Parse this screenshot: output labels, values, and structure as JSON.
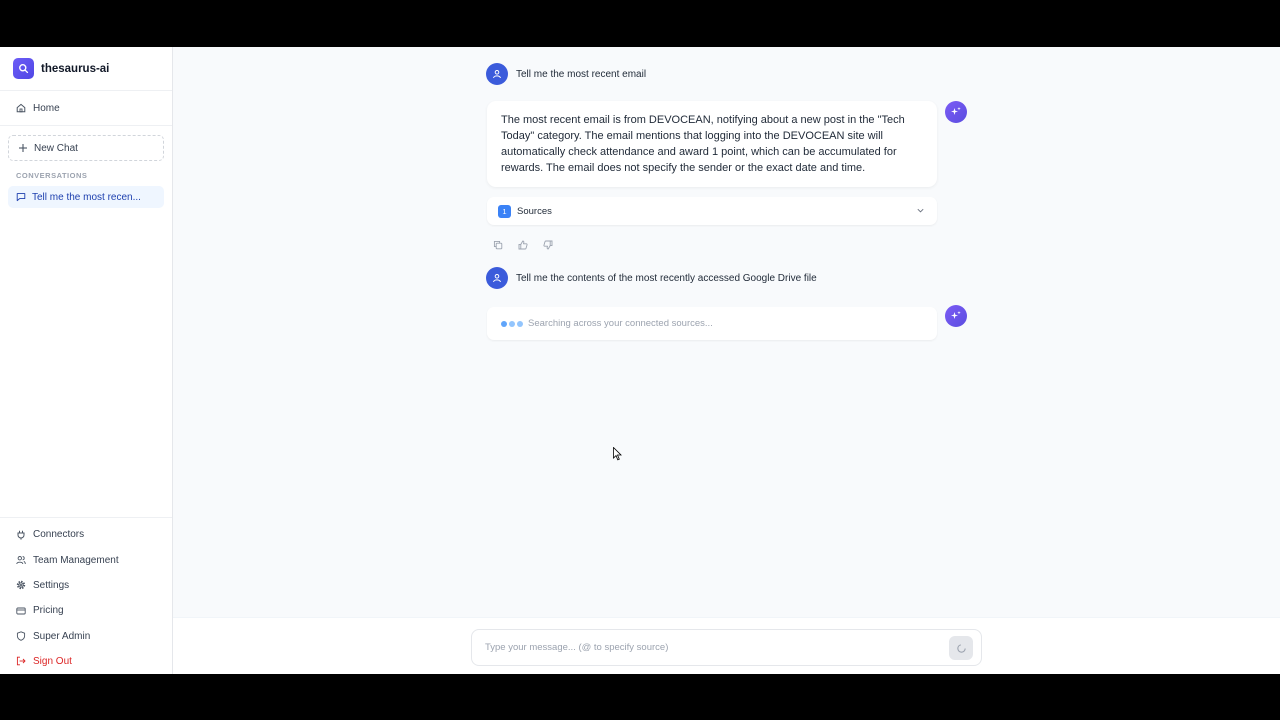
{
  "app": {
    "name": "thesaurus-ai"
  },
  "sidebar": {
    "home": "Home",
    "new_chat": "New Chat",
    "conversations_heading": "CONVERSATIONS",
    "conversations": [
      {
        "label": "Tell me the most recen..."
      }
    ],
    "bottom_nav": [
      {
        "label": "Connectors",
        "icon": "plug-icon"
      },
      {
        "label": "Team Management",
        "icon": "users-icon"
      },
      {
        "label": "Settings",
        "icon": "gear-icon"
      },
      {
        "label": "Pricing",
        "icon": "credit-card-icon"
      },
      {
        "label": "Super Admin",
        "icon": "shield-icon"
      },
      {
        "label": "Sign Out",
        "icon": "sign-out-icon"
      }
    ]
  },
  "chat": {
    "messages": [
      {
        "role": "user",
        "text": "Tell me the most recent email"
      },
      {
        "role": "assistant",
        "text": "The most recent email is from DEVOCEAN, notifying about a new post in the \"Tech Today\" category. The email mentions that logging into the DEVOCEAN site will automatically check attendance and award 1 point, which can be accumulated for rewards. The email does not specify the sender or the exact date and time.",
        "sources_count": "1",
        "sources_label": "Sources"
      },
      {
        "role": "user",
        "text": "Tell me the contents of the most recently accessed Google Drive file"
      },
      {
        "role": "assistant",
        "status": "Searching across your connected sources..."
      }
    ]
  },
  "composer": {
    "placeholder": "Type your message... (@ to specify source)"
  },
  "colors": {
    "accent": "#4f46e5",
    "user_avatar": "#3b5bdb",
    "signout": "#dc2626"
  }
}
